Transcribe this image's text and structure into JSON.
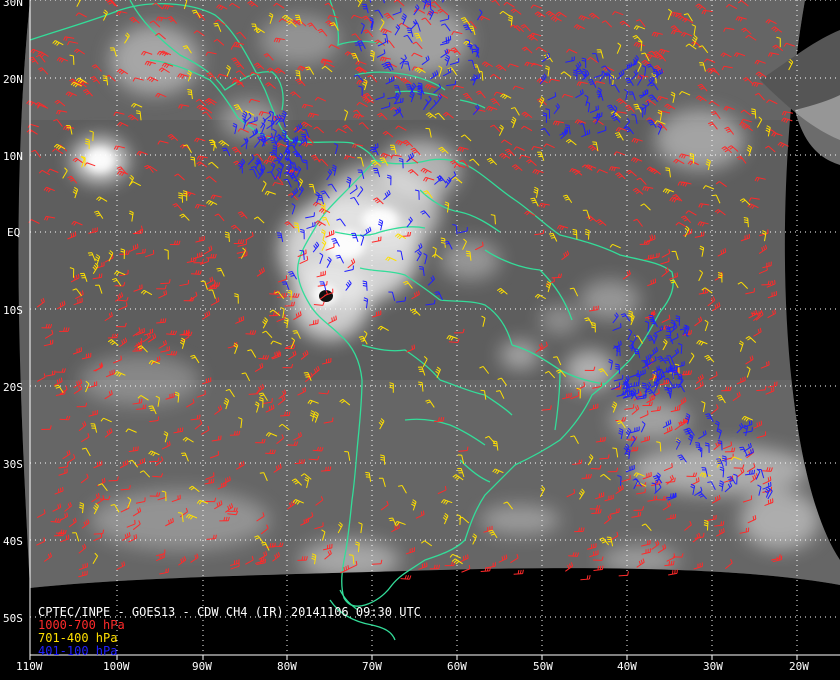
{
  "map": {
    "caption": "CPTEC/INPE - GOES13 - CDW CH4 (IR) 20141106 09:30 UTC",
    "lat_labels": [
      "30N",
      "20N",
      "10N",
      "EQ",
      "10S",
      "20S",
      "30S",
      "40S",
      "50S"
    ],
    "lon_labels": [
      "110W",
      "100W",
      "90W",
      "80W",
      "70W",
      "60W",
      "50W",
      "40W",
      "30W",
      "20W"
    ],
    "legend": [
      {
        "label": "1000-700 hPa",
        "color": "#ff2a2a"
      },
      {
        "label": "701-400 hPa",
        "color": "#ffe000"
      },
      {
        "label": "401-100 hPa",
        "color": "#2020ff"
      }
    ],
    "colors": {
      "background": "#000000",
      "coast": "#33dd99",
      "grid": "#ffffff",
      "cloud": "#e8e8e8"
    }
  }
}
